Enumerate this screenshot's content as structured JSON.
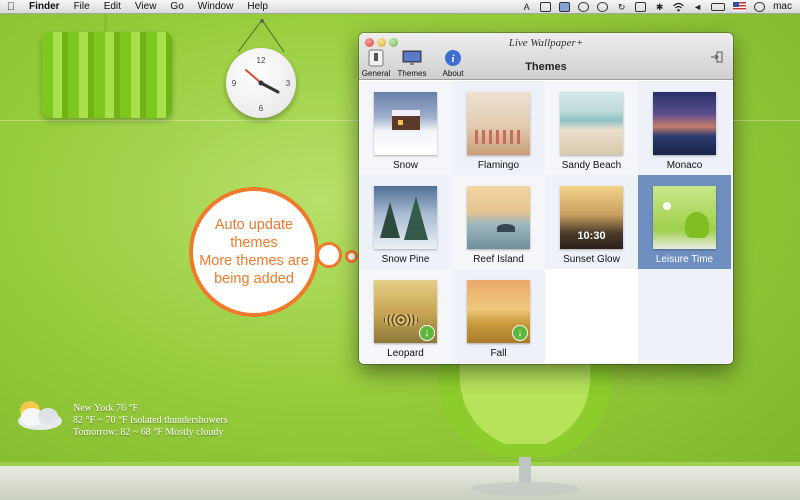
{
  "menubar": {
    "app_name": "Finder",
    "items": [
      "File",
      "Edit",
      "View",
      "Go",
      "Window",
      "Help"
    ],
    "user": "mac"
  },
  "clock": {
    "numbers": {
      "twelve": "12",
      "three": "3",
      "six": "6",
      "nine": "9"
    }
  },
  "callout": {
    "lines": [
      "Auto update",
      "themes",
      "More themes are",
      "being added"
    ]
  },
  "weather": {
    "line1": "New York 76 °F",
    "line2": "82 °F ~ 70 °F Isolated thundershowers",
    "line3": "Tomorrow: 82 ~ 68 °F  Mostly cloudy"
  },
  "window": {
    "title": "Live Wallpaper+",
    "section_title": "Themes",
    "toolbar": [
      {
        "label": "General",
        "icon": "switch-icon"
      },
      {
        "label": "Themes",
        "icon": "display-icon"
      },
      {
        "label": "About",
        "icon": "info-icon"
      }
    ],
    "themes": [
      {
        "label": "Snow",
        "downloadable": false,
        "selected": false
      },
      {
        "label": "Flamingo",
        "downloadable": false,
        "selected": false
      },
      {
        "label": "Sandy Beach",
        "downloadable": false,
        "selected": false
      },
      {
        "label": "Monaco",
        "downloadable": false,
        "selected": false
      },
      {
        "label": "Snow Pine",
        "downloadable": false,
        "selected": false
      },
      {
        "label": "Reef Island",
        "downloadable": false,
        "selected": false
      },
      {
        "label": "Sunset Glow",
        "downloadable": false,
        "selected": false,
        "thumb_text": "10:30"
      },
      {
        "label": "Leisure Time",
        "downloadable": false,
        "selected": true
      },
      {
        "label": "Leopard",
        "downloadable": true,
        "selected": false
      },
      {
        "label": "Fall",
        "downloadable": true,
        "selected": false
      }
    ]
  },
  "colors": {
    "accent_orange": "#f07a2a",
    "selection_blue": "#6e8fc0",
    "download_green": "#5cb83a"
  }
}
